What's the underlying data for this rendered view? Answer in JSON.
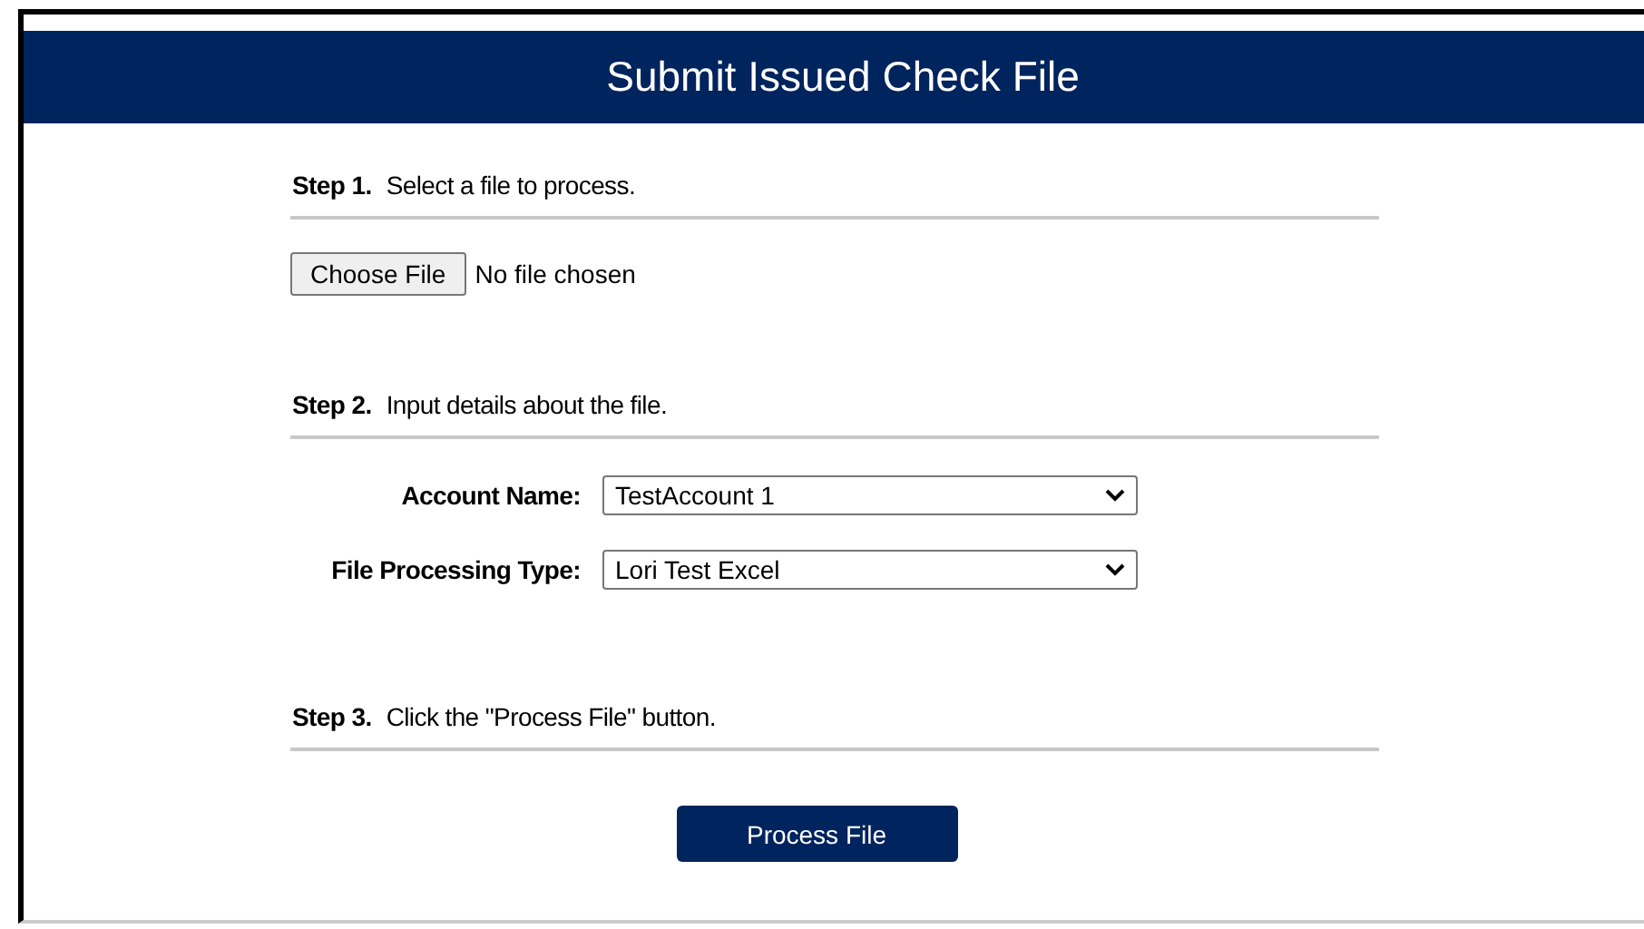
{
  "title": "Submit Issued Check File",
  "steps": [
    {
      "label": "Step 1.",
      "instruction": "Select a file to process."
    },
    {
      "label": "Step 2.",
      "instruction": "Input details about the file."
    },
    {
      "label": "Step 3.",
      "instruction": "Click the \"Process File\" button."
    }
  ],
  "file_input": {
    "button": "Choose File",
    "status": "No file chosen"
  },
  "fields": [
    {
      "label": "Account Name:",
      "value": "TestAccount 1"
    },
    {
      "label": "File Processing Type:",
      "value": "Lori Test Excel"
    }
  ],
  "submit_button": "Process File"
}
